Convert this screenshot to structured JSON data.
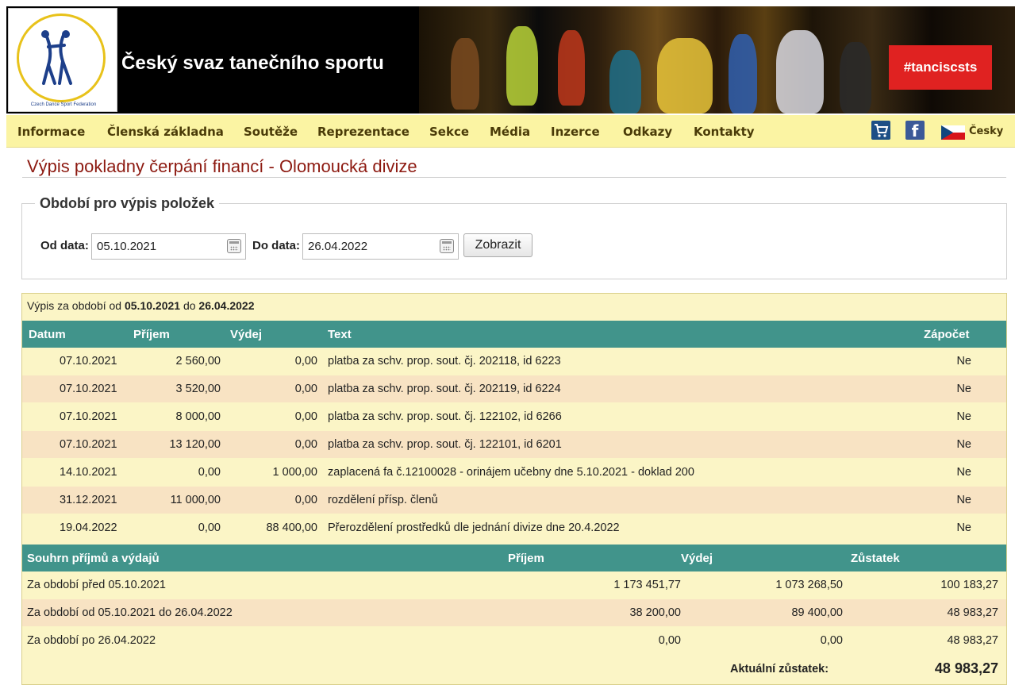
{
  "header": {
    "site_title": "Český svaz tanečního sportu",
    "logo_caption": "Czech Dance Sport Federation",
    "hashtag": "#tanciscsts"
  },
  "nav": {
    "items": [
      "Informace",
      "Členská základna",
      "Soutěže",
      "Reprezentace",
      "Sekce",
      "Média",
      "Inzerce",
      "Odkazy",
      "Kontakty"
    ],
    "language": "Česky",
    "icons": [
      "cart-icon",
      "facebook-icon",
      "czech-flag-icon"
    ]
  },
  "page": {
    "title": "Výpis pokladny čerpání financí - Olomoucká divize"
  },
  "filter": {
    "legend": "Období pro výpis položek",
    "from_label": "Od data:",
    "from_value": "05.10.2021",
    "to_label": "Do data:",
    "to_value": "26.04.2022",
    "submit_label": "Zobrazit"
  },
  "statement": {
    "period_prefix": "Výpis za období od",
    "period_from": "05.10.2021",
    "period_mid": "do",
    "period_to": "26.04.2022",
    "columns": [
      "Datum",
      "Příjem",
      "Výdej",
      "Text",
      "Zápočet"
    ],
    "rows": [
      {
        "date": "07.10.2021",
        "income": "2 560,00",
        "expense": "0,00",
        "text": "platba za schv. prop. sout. čj. 202118, id 6223",
        "credit": "Ne"
      },
      {
        "date": "07.10.2021",
        "income": "3 520,00",
        "expense": "0,00",
        "text": "platba za schv. prop. sout. čj. 202119, id 6224",
        "credit": "Ne"
      },
      {
        "date": "07.10.2021",
        "income": "8 000,00",
        "expense": "0,00",
        "text": "platba za schv. prop. sout. čj. 122102, id 6266",
        "credit": "Ne"
      },
      {
        "date": "07.10.2021",
        "income": "13 120,00",
        "expense": "0,00",
        "text": "platba za schv. prop. sout. čj. 122101, id 6201",
        "credit": "Ne"
      },
      {
        "date": "14.10.2021",
        "income": "0,00",
        "expense": "1 000,00",
        "text": "zaplacená fa č.12100028 - orinájem učebny dne 5.10.2021 - doklad 200",
        "credit": "Ne"
      },
      {
        "date": "31.12.2021",
        "income": "11 000,00",
        "expense": "0,00",
        "text": "rozdělení přísp. členů",
        "credit": "Ne"
      },
      {
        "date": "19.04.2022",
        "income": "0,00",
        "expense": "88 400,00",
        "text": "Přerozdělení prostředků dle jednání divize dne 20.4.2022",
        "credit": "Ne"
      }
    ]
  },
  "summary": {
    "columns": [
      "Souhrn příjmů a výdajů",
      "Příjem",
      "Výdej",
      "Zůstatek"
    ],
    "rows": [
      {
        "label": "Za období před 05.10.2021",
        "income": "1 173 451,77",
        "expense": "1 073 268,50",
        "balance": "100 183,27"
      },
      {
        "label": "Za období od 05.10.2021 do 26.04.2022",
        "income": "38 200,00",
        "expense": "89 400,00",
        "balance": "48 983,27"
      },
      {
        "label": "Za období po 26.04.2022",
        "income": "0,00",
        "expense": "0,00",
        "balance": "48 983,27"
      }
    ],
    "current_balance_label": "Aktuální zůstatek:",
    "current_balance_value": "48 983,27"
  }
}
